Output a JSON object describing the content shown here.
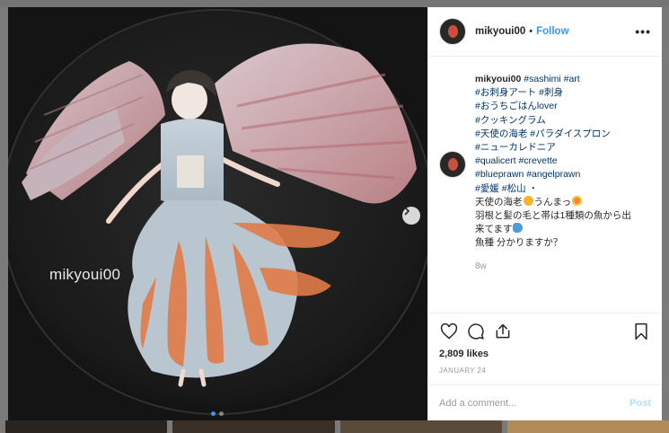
{
  "post": {
    "username": "mikyoui00",
    "separator": "•",
    "follow_label": "Follow",
    "more_label": "•••",
    "watermark": "mikyoui00",
    "caption_lines": [
      {
        "user": "mikyoui00",
        "text": "#sashimi #art",
        "kind": "tag"
      },
      {
        "text": "#お刺身アート #刺身",
        "kind": "tag"
      },
      {
        "text": "#おうちごはんlover",
        "kind": "tag"
      },
      {
        "text": "#クッキングラム",
        "kind": "tag"
      },
      {
        "text": "#天使の海老 #パラダイスプロン",
        "kind": "tag"
      },
      {
        "text": "#ニューカレドニア",
        "kind": "tag"
      },
      {
        "text": "#qualicert #crevette",
        "kind": "tag"
      },
      {
        "text": "#blueprawn #angelprawn",
        "kind": "tag"
      },
      {
        "text": "#愛媛 #松山 ・",
        "kind": "tag"
      },
      {
        "text": "天使の海老",
        "after": "うんまっ",
        "kind": "text"
      },
      {
        "text": "羽根と髪の毛と帯は1種類の魚から出",
        "kind": "text"
      },
      {
        "text": "来てます",
        "kind": "text"
      },
      {
        "text": "魚種 分かりますか？",
        "kind": "text"
      }
    ],
    "time_ago": "8w",
    "likes": "2,809 likes",
    "date": "JANUARY 24",
    "comment_placeholder": "Add a comment...",
    "post_label": "Post",
    "icons": {
      "heart": "heart-icon",
      "comment": "comment-icon",
      "share": "share-icon",
      "bookmark": "bookmark-icon",
      "next": "chevron-right-icon"
    },
    "colors": {
      "link": "#3897f0",
      "hashtag": "#003569",
      "muted": "#999999",
      "post_disabled": "#b2dffc"
    }
  }
}
